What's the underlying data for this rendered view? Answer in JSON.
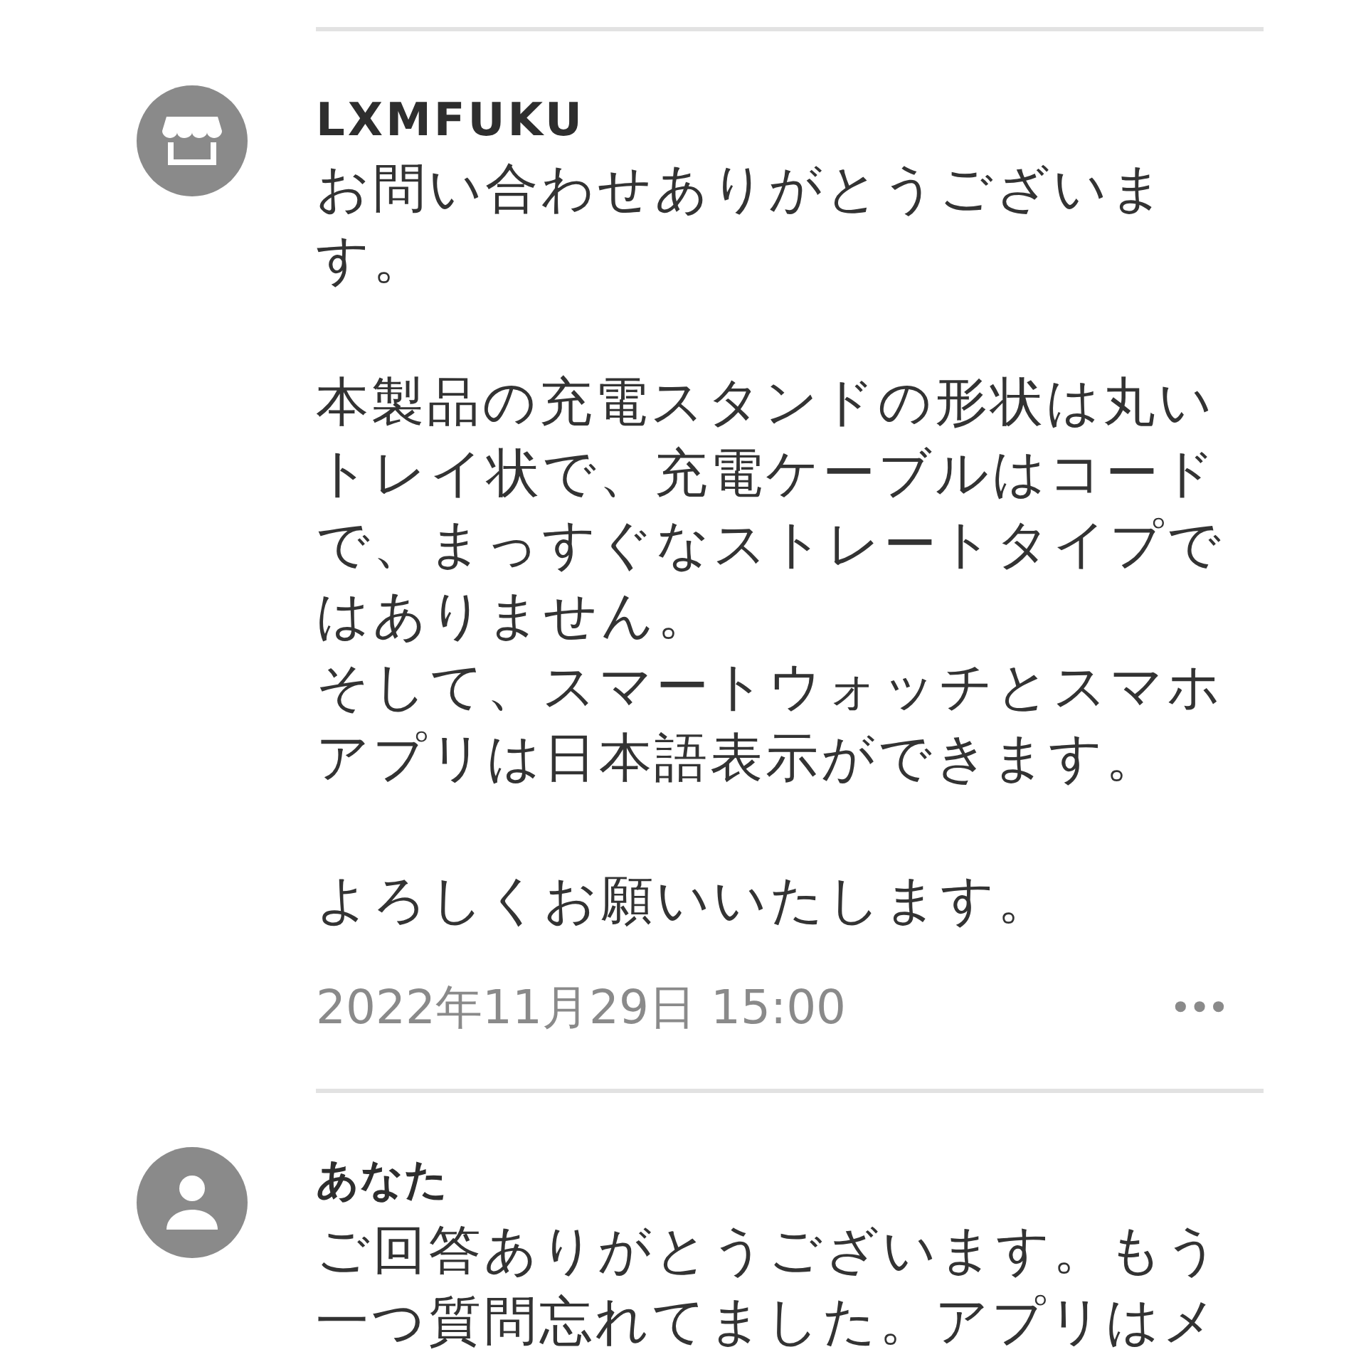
{
  "messages": [
    {
      "kind": "shop",
      "author": "LXMFUKU",
      "body": [
        [
          "お問い合わせありがとうございます。"
        ],
        [
          "本製品の充電スタンドの形状は丸いトレイ状で、充電ケーブルはコードで、まっすぐなストレートタイプではありません。",
          "そして、スマートウォッチとスマホアプリは日本語表示ができます。"
        ],
        [
          "よろしくお願いいたします。"
        ]
      ],
      "date": "2022年11月29日 15:00",
      "menu": "•••"
    },
    {
      "kind": "user",
      "author": "あなた",
      "body": [
        [
          "ご回答ありがとうございます。もう一つ質問忘れてました。アプリはメ"
        ]
      ]
    }
  ]
}
